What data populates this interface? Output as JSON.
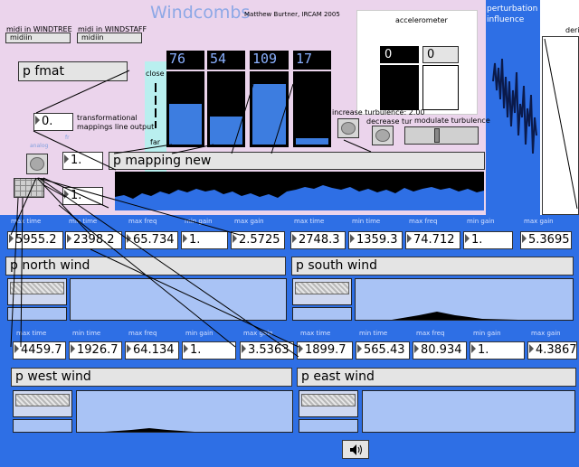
{
  "header": {
    "title": "Windcombs",
    "credit": "Matthew Burtner, IRCAM 2005"
  },
  "midi": {
    "windtree_label": "midi in WINDTREE",
    "windtree_object": "midiin",
    "windstaff_label": "midi in WINDSTAFF",
    "windstaff_object": "midiin"
  },
  "fmat_object": "p fmat",
  "transform": {
    "value": "0.",
    "label_line1": "transformational",
    "label_line2": "mappings line output"
  },
  "range_labels": {
    "close": "close",
    "far": "far"
  },
  "sliders": {
    "values": [
      "76",
      "54",
      "109",
      "17"
    ],
    "levels": [
      0.6,
      0.43,
      0.86,
      0.13
    ],
    "color": "#3d7de0"
  },
  "turbulence": {
    "increase_label": "increase turbulence: 2.00",
    "decrease_label": "decrease tur",
    "modulate_label": "modulate turbulence"
  },
  "accelerometer": {
    "label": "accelerometer",
    "x_value": "0",
    "y_value": "0"
  },
  "perturbation": {
    "label_line1": "perturbation",
    "label_line2": "influence"
  },
  "right_panel_label": "deri",
  "mapping": {
    "small_label_1": "analog",
    "small_label_2": "fr",
    "value1": "1.",
    "value2": "1.",
    "object": "p mapping new"
  },
  "top_params": [
    {
      "label": "max time",
      "value": "5955.2"
    },
    {
      "label": "min time",
      "value": "2398.2"
    },
    {
      "label": "max freq",
      "value": "65.734"
    },
    {
      "label": "min gain",
      "value": "1."
    },
    {
      "label": "max gain",
      "value": "2.5725"
    },
    {
      "label": "max time",
      "value": "2748.3"
    },
    {
      "label": "min time",
      "value": "1359.3"
    },
    {
      "label": "max freq",
      "value": "74.712"
    },
    {
      "label": "min gain",
      "value": "1."
    },
    {
      "label": "max gain",
      "value": "5.3695"
    }
  ],
  "bottom_params": [
    {
      "label": "max time",
      "value": "4459.7"
    },
    {
      "label": "min time",
      "value": "1926.7"
    },
    {
      "label": "max freq",
      "value": "64.134"
    },
    {
      "label": "min gain",
      "value": "1."
    },
    {
      "label": "max gain",
      "value": "3.5363"
    },
    {
      "label": "max time",
      "value": "1899.7"
    },
    {
      "label": "min time",
      "value": "565.43"
    },
    {
      "label": "max freq",
      "value": "80.934"
    },
    {
      "label": "min gain",
      "value": "1."
    },
    {
      "label": "max gain",
      "value": "4.3867"
    }
  ],
  "winds": {
    "north": "p north wind",
    "south": "p south wind",
    "west": "p west wind",
    "east": "p east wind"
  },
  "speaker_icon": "speaker-icon",
  "colors": {
    "patch_pink": "#ebd4ec",
    "patch_blue": "#2e6fe5",
    "panel_light": "#a9c3f5"
  }
}
